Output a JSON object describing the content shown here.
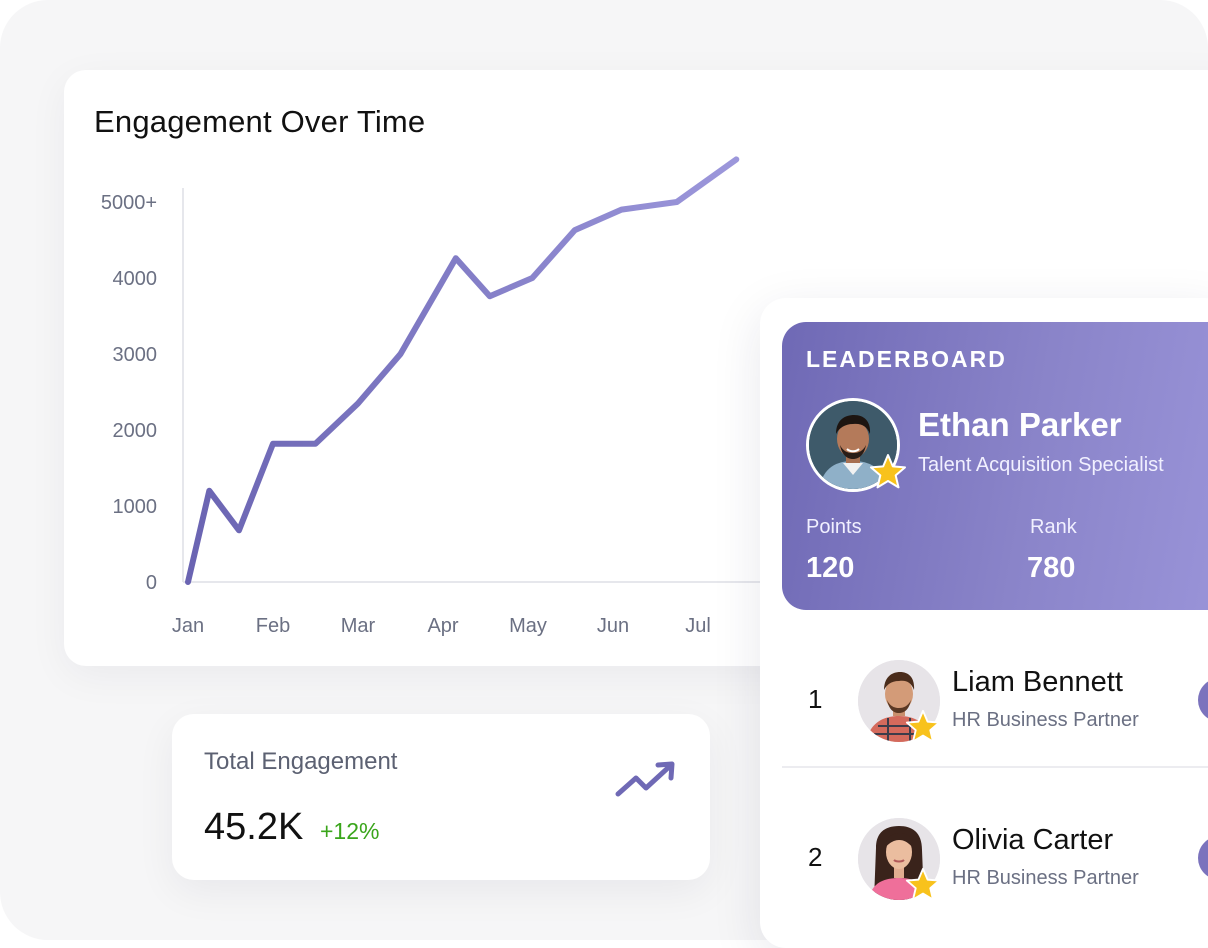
{
  "chart_card": {
    "title": "Engagement Over Time"
  },
  "chart_data": {
    "type": "line",
    "title": "Engagement Over Time",
    "x_categories": [
      "Jan",
      "Feb",
      "Mar",
      "Apr",
      "May",
      "Jun",
      "Jul"
    ],
    "y_ticks": [
      "0",
      "1000",
      "2000",
      "3000",
      "4000",
      "5000+"
    ],
    "ylim": [
      0,
      5000
    ],
    "grid": false,
    "series": [
      {
        "color": "#6f69b5",
        "x": [
          0,
          0.5,
          1.2,
          2,
          3,
          4,
          5,
          6.3,
          7.1,
          8.1,
          9.1,
          10.2,
          11.5,
          12.9
        ],
        "values": [
          0,
          1200,
          680,
          1820,
          1820,
          2350,
          3000,
          4260,
          3760,
          4000,
          4630,
          4900,
          5000,
          5560
        ]
      }
    ],
    "line_color_start": "#6a64b2",
    "line_color_end": "#9c97db"
  },
  "total_card": {
    "label": "Total Engagement",
    "value": "45.2K",
    "change": "+12%",
    "change_color": "#3aa51b",
    "icon": "trending-up-icon"
  },
  "leaderboard": {
    "title": "LEADERBOARD",
    "top": {
      "name": "Ethan Parker",
      "role": "Talent Acquisition Specialist",
      "points_label": "Points",
      "points": "120",
      "rank_label": "Rank",
      "rank": "780"
    },
    "rows": [
      {
        "rank": "1",
        "name": "Liam Bennett",
        "role": "HR Business Partner"
      },
      {
        "rank": "2",
        "name": "Olivia Carter",
        "role": "HR Business Partner"
      }
    ]
  },
  "colors": {
    "accent": "#6f69b5",
    "star": "#f8c21c",
    "muted_text": "#6b7083"
  }
}
